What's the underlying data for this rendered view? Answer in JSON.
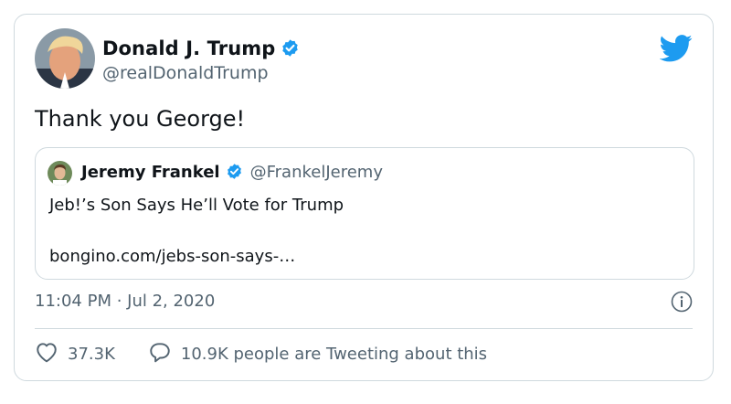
{
  "author": {
    "name": "Donald J. Trump",
    "handle": "@realDonaldTrump"
  },
  "tweet": {
    "text": "Thank you George!",
    "timestamp": "11:04 PM · Jul 2, 2020"
  },
  "quoted_tweet": {
    "name": "Jeremy Frankel",
    "handle": "@FrankelJeremy",
    "text": "Jeb!’s Son Says He’ll Vote for Trump",
    "link": "bongino.com/jebs-son-says-…"
  },
  "stats": {
    "likes": "37.3K",
    "tweeting": "10.9K people are Tweeting about this"
  },
  "icons": {
    "brand": "twitter-bird-icon",
    "verified": "verified-badge-icon",
    "info": "info-icon",
    "like": "heart-icon",
    "reply": "speech-bubble-icon"
  },
  "colors": {
    "twitter_blue": "#1d9bf0",
    "secondary_text": "#536471",
    "border": "#cfd9de"
  }
}
